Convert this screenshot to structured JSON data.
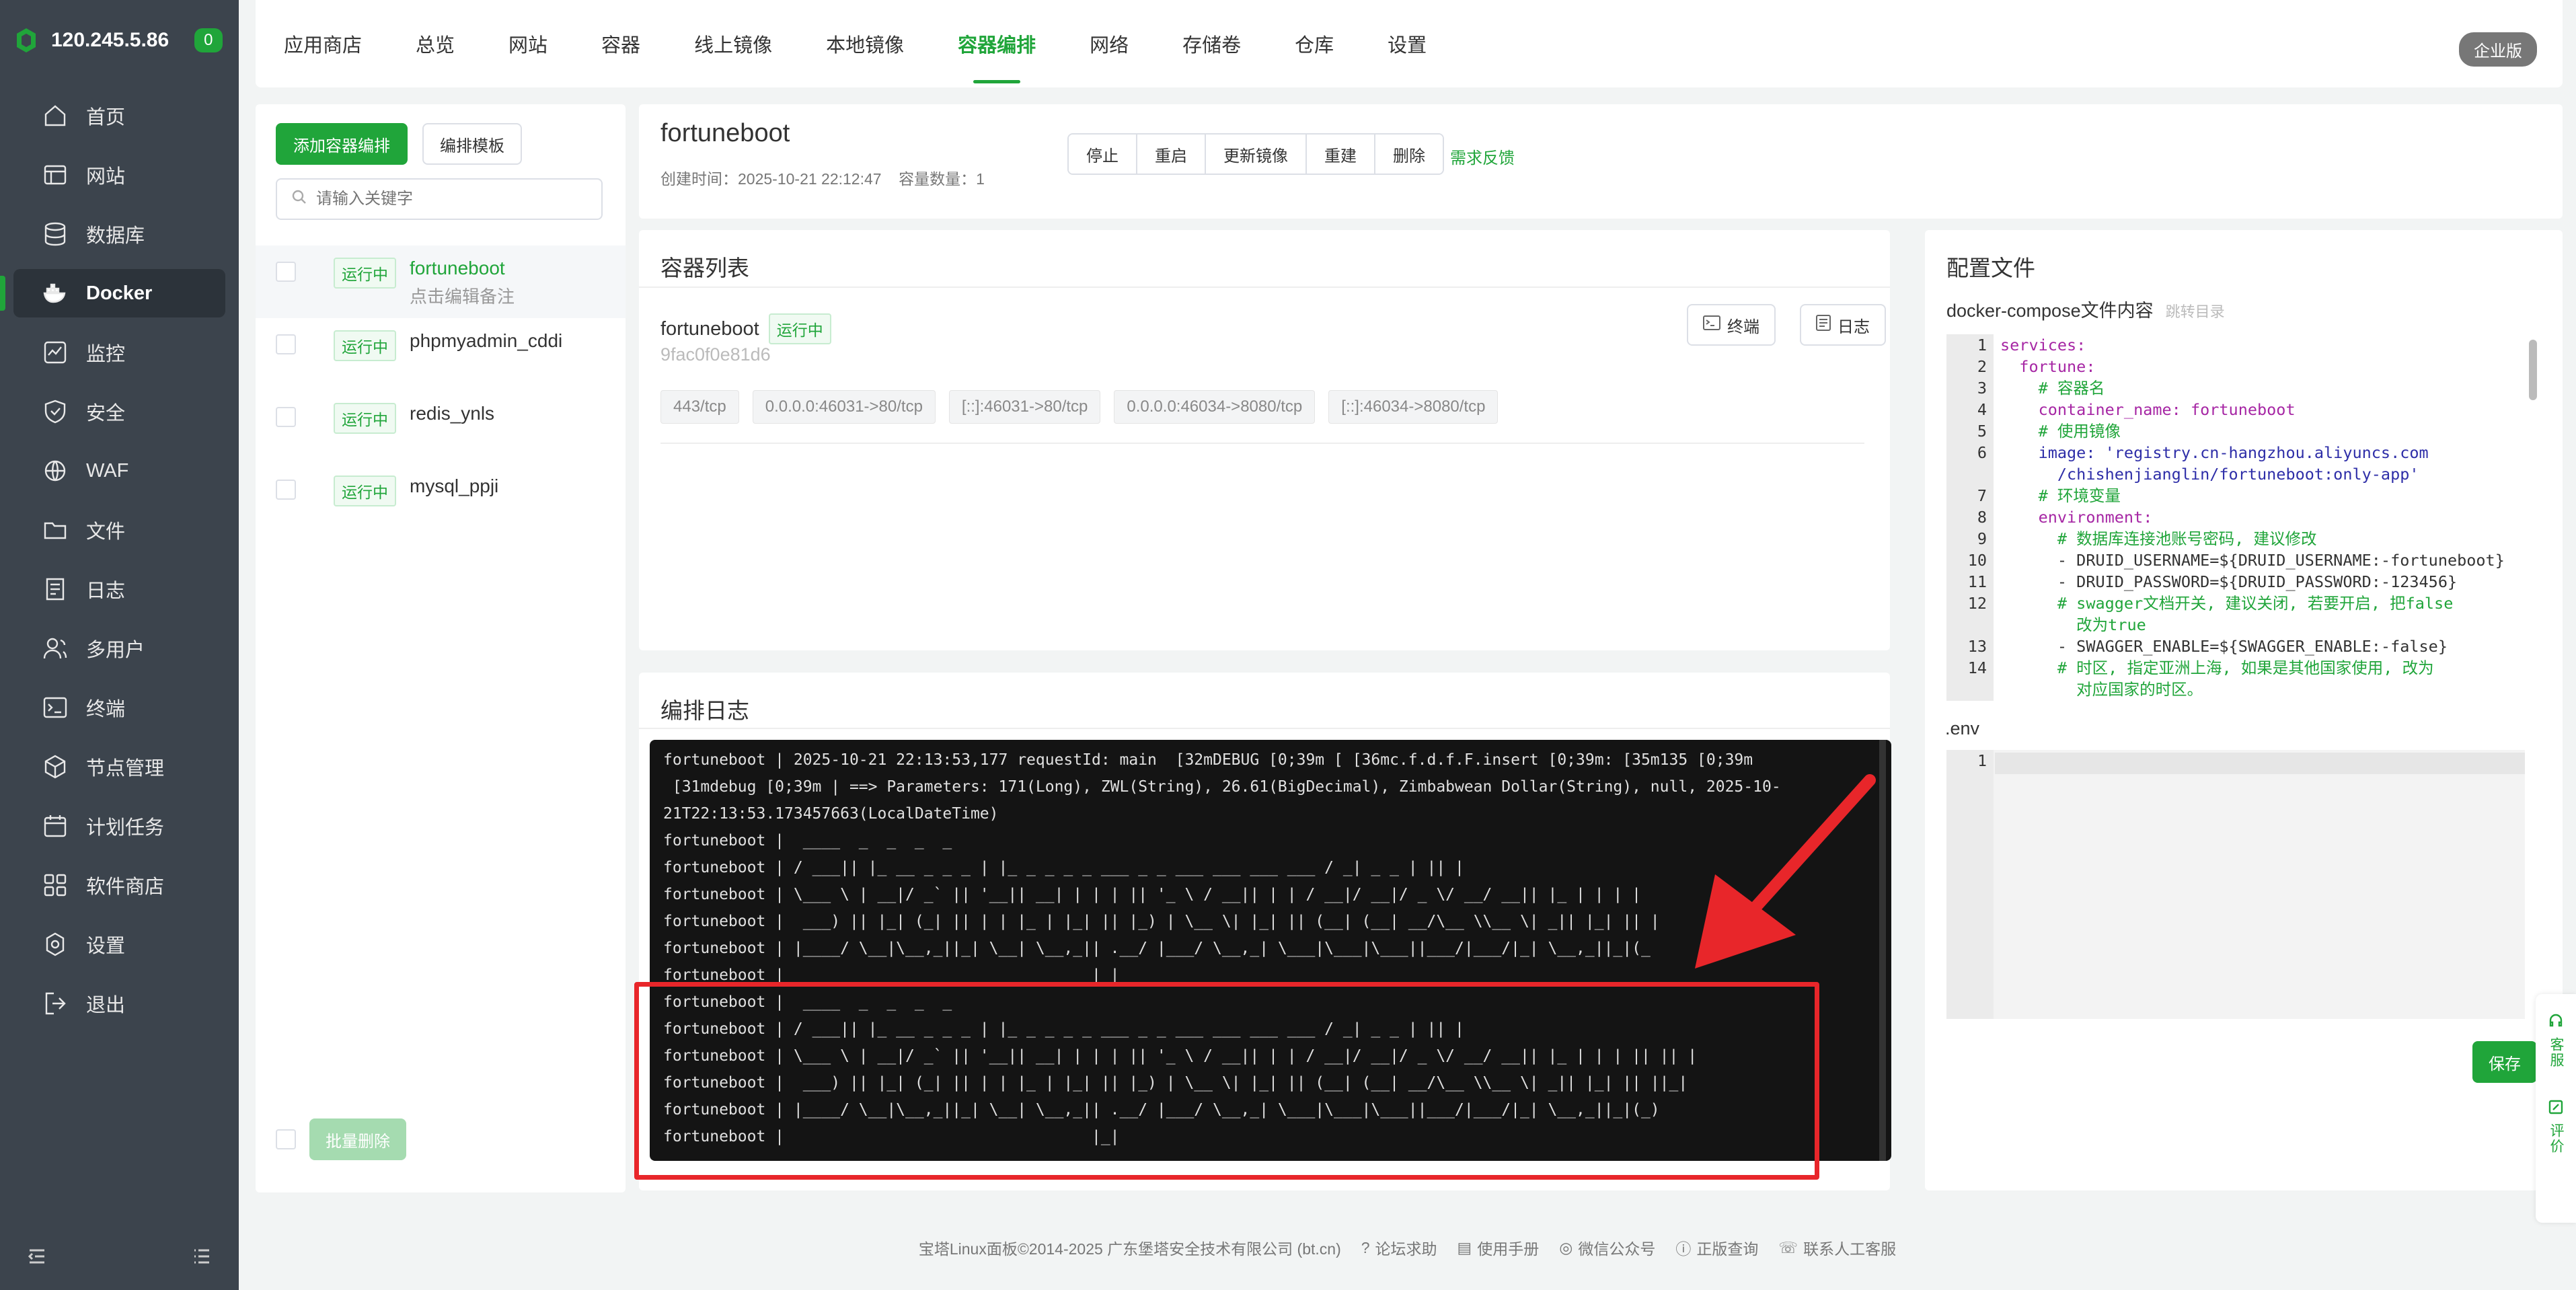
{
  "sidebar": {
    "ip": "120.245.5.86",
    "badge": "0",
    "items": [
      {
        "label": "首页",
        "icon": "home-icon"
      },
      {
        "label": "网站",
        "icon": "website-icon"
      },
      {
        "label": "数据库",
        "icon": "database-icon"
      },
      {
        "label": "Docker",
        "icon": "docker-icon"
      },
      {
        "label": "监控",
        "icon": "monitor-icon"
      },
      {
        "label": "安全",
        "icon": "shield-icon"
      },
      {
        "label": "WAF",
        "icon": "waf-icon"
      },
      {
        "label": "文件",
        "icon": "folder-icon"
      },
      {
        "label": "日志",
        "icon": "log-icon"
      },
      {
        "label": "多用户",
        "icon": "users-icon"
      },
      {
        "label": "终端",
        "icon": "terminal-icon"
      },
      {
        "label": "节点管理",
        "icon": "node-icon"
      },
      {
        "label": "计划任务",
        "icon": "calendar-icon"
      },
      {
        "label": "软件商店",
        "icon": "store-icon"
      },
      {
        "label": "设置",
        "icon": "gear-icon"
      },
      {
        "label": "退出",
        "icon": "logout-icon"
      }
    ]
  },
  "topbar": {
    "tabs": [
      "应用商店",
      "总览",
      "网站",
      "容器",
      "线上镜像",
      "本地镜像",
      "容器编排",
      "网络",
      "存储卷",
      "仓库",
      "设置"
    ],
    "active_tab": "容器编排",
    "enterprise": "企业版"
  },
  "compose_list": {
    "add_button": "添加容器编排",
    "template_button": "编排模板",
    "search_placeholder": "请输入关键字",
    "items": [
      {
        "status": "运行中",
        "name": "fortuneboot",
        "note": "点击编辑备注"
      },
      {
        "status": "运行中",
        "name": "phpmyadmin_cddi"
      },
      {
        "status": "运行中",
        "name": "redis_ynls"
      },
      {
        "status": "运行中",
        "name": "mysql_ppji"
      }
    ],
    "bulk_delete": "批量删除"
  },
  "detail": {
    "title": "fortuneboot",
    "created_label": "创建时间：",
    "created_value": "2025-10-21 22:12:47",
    "count_label": "容量数量：",
    "count_value": "1",
    "actions": [
      "停止",
      "重启",
      "更新镜像",
      "重建",
      "删除"
    ],
    "feedback": "需求反馈"
  },
  "containers": {
    "title": "容器列表",
    "name": "fortuneboot",
    "status": "运行中",
    "id": "9fac0f0e81d6",
    "ports": [
      "443/tcp",
      "0.0.0.0:46031->80/tcp",
      "[::]:46031->80/tcp",
      "0.0.0.0:46034->8080/tcp",
      "[::]:46034->8080/tcp"
    ],
    "terminal_button": "终端",
    "log_button": "日志"
  },
  "logs": {
    "title": "编排日志",
    "lines": [
      "fortuneboot | 2025-10-21 22:13:53,177 requestId: main  [32mDEBUG [0;39m [ [36mc.f.d.f.F.insert [0;39m: [35m135 [0;39m",
      " [31mdebug [0;39m | ==> Parameters: 171(Long), ZWL(String), 26.61(BigDecimal), Zimbabwean Dollar(String), null, 2025-10-",
      "21T22:13:53.173457663(LocalDateTime)",
      "fortuneboot |  ____  _  _  _  _",
      "fortuneboot | / ___|| |_ __ _ _ _ | |_ _ _ _ _ ___ _ _ ___ ___ ___ ___ / _| _ _ | || |",
      "fortuneboot | \\___ \\ | __|/ _` || '__|| __| | | | || '_ \\ / __|| | | / __|/ __|/ _ \\/ __/ __|| |_ | | | |",
      "fortuneboot |  ___) || |_| (_| || | | |_ | |_| || |_) | \\__ \\| |_| || (__| (__| __/\\__ \\\\__ \\| _|| |_| || |",
      "fortuneboot | |____/ \\__|\\__,_||_| \\__| \\__,_|| .__/ |___/ \\__,_| \\___|\\___|\\___||___/|___/|_| \\__,_||_|(_",
      "fortuneboot |                                 |_|",
      "fortuneboot |  ____  _  _  _  _",
      "fortuneboot | / ___|| |_ __ _ _ _ | |_ _ _ _ _ ___ _ _ ___ ___ ___ ___ / _| _ _ | || |",
      "fortuneboot | \\___ \\ | __|/ _` || '__|| __| | | | || '_ \\ / __|| | | / __|/ __|/ _ \\/ __/ __|| |_ | | | || || |",
      "fortuneboot |  ___) || |_| (_| || | | |_ | |_| || |_) | \\__ \\| |_| || (__| (__| __/\\__ \\\\__ \\| _|| |_| || ||_|",
      "fortuneboot | |____/ \\__|\\__,_||_| \\__| \\__,_|| .__/ |___/ \\__,_| \\___|\\___|\\___||___/|___/|_| \\__,_||_|(_)",
      "fortuneboot |                                 |_|"
    ]
  },
  "config": {
    "title": "配置文件",
    "subtitle": "docker-compose文件内容",
    "jump": "跳转目录",
    "code_lines": [
      {
        "n": "1",
        "t": "services:"
      },
      {
        "n": "2",
        "t": "  fortune:"
      },
      {
        "n": "3",
        "t": "    # 容器名"
      },
      {
        "n": "4",
        "t": "    container_name: fortuneboot"
      },
      {
        "n": "5",
        "t": "    # 使用镜像"
      },
      {
        "n": "6",
        "t": "    image: 'registry.cn-hangzhou.aliyuncs.com\n      /chishenjianglin/fortuneboot:only-app'"
      },
      {
        "n": "7",
        "t": "    # 环境变量"
      },
      {
        "n": "8",
        "t": "    environment:"
      },
      {
        "n": "9",
        "t": "      # 数据库连接池账号密码, 建议修改"
      },
      {
        "n": "10",
        "t": "      - DRUID_USERNAME=${DRUID_USERNAME:-fortuneboot}"
      },
      {
        "n": "11",
        "t": "      - DRUID_PASSWORD=${DRUID_PASSWORD:-123456}"
      },
      {
        "n": "12",
        "t": "      # swagger文档开关, 建议关闭, 若要开启, 把false\n        改为true"
      },
      {
        "n": "13",
        "t": "      - SWAGGER_ENABLE=${SWAGGER_ENABLE:-false}"
      },
      {
        "n": "14",
        "t": "      # 时区, 指定亚洲上海, 如果是其他国家使用, 改为\n        对应国家的时区。"
      }
    ],
    "env_label": ".env",
    "env_line": "1",
    "save": "保存"
  },
  "float": {
    "service": "客服",
    "review": "评价"
  },
  "footer": {
    "copyright": "宝塔Linux面板©2014-2025 广东堡塔安全技术有限公司 (bt.cn)",
    "links": [
      "论坛求助",
      "使用手册",
      "微信公众号",
      "正版查询",
      "联系人工客服"
    ]
  },
  "colors": {
    "accent": "#20a53a",
    "sidebar": "#3c444d",
    "highlight": "#e8262a"
  }
}
